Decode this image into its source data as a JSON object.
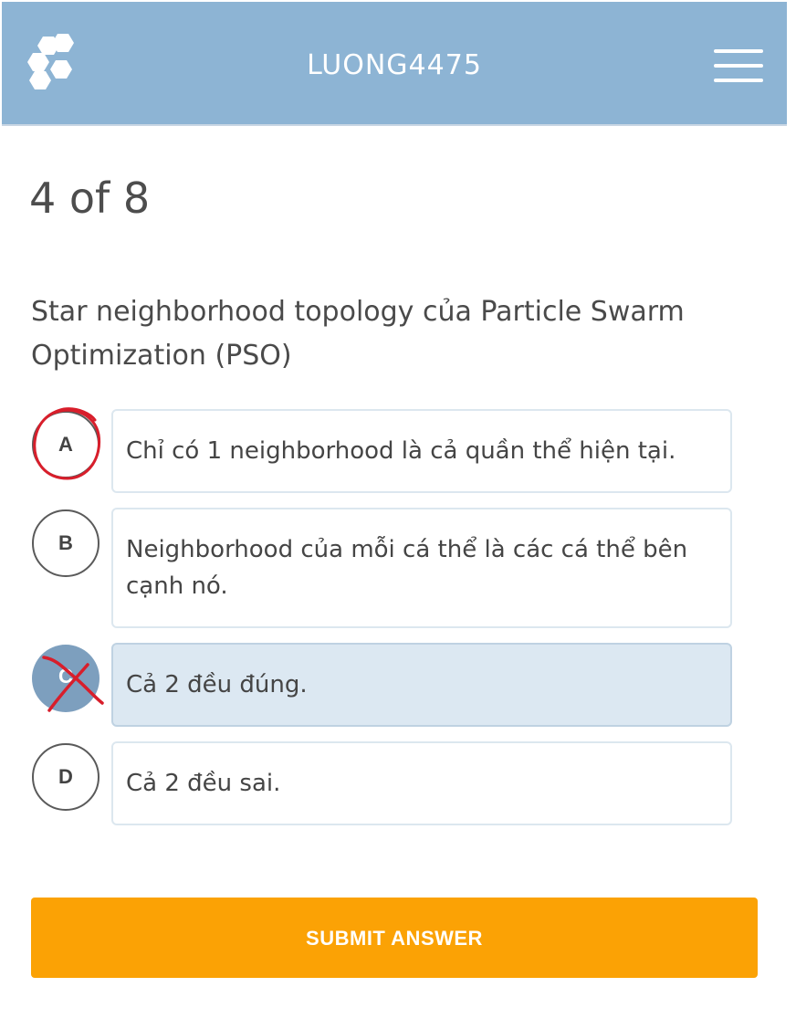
{
  "header": {
    "title": "LUONG4475",
    "logo_icon": "hexagon-cluster-icon",
    "menu_icon": "hamburger-menu-icon",
    "background": "#8db4d4"
  },
  "quiz": {
    "progress_text": "4 of 8",
    "question_line1": "Star neighborhood topology của Particle Swarm",
    "question_line2": "Optimization (PSO)",
    "options": [
      {
        "letter": "A",
        "text": "Chỉ có 1 neighborhood là cả quần thể hiện tại.",
        "selected": false,
        "annotation": "red-circle"
      },
      {
        "letter": "B",
        "text": "Neighborhood của mỗi cá thể là các cá thể bên cạnh nó.",
        "selected": false
      },
      {
        "letter": "C",
        "text": "Cả 2 đều đúng.",
        "selected": true,
        "annotation": "red-cross"
      },
      {
        "letter": "D",
        "text": "Cả 2 đều sai.",
        "selected": false
      }
    ],
    "submit_label": "SUBMIT ANSWER"
  },
  "colors": {
    "accent": "#fba205",
    "selected_letter": "#7d9fbe",
    "selected_box": "#dce8f2",
    "annotation": "#d81e2b"
  }
}
